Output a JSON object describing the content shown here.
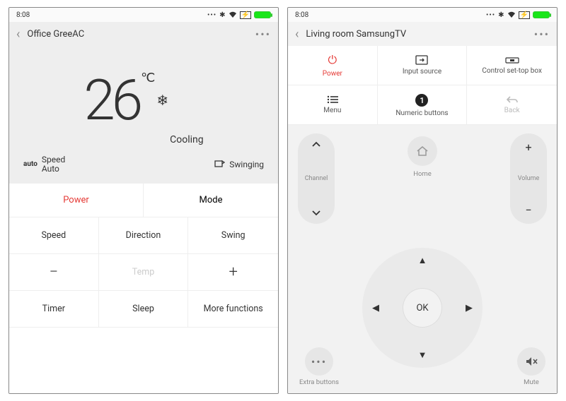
{
  "status": {
    "time": "8:08"
  },
  "left": {
    "title": "Office GreeAC",
    "temperature": "26",
    "unit": "℃",
    "mode_label": "Cooling",
    "speed_label1": "Speed",
    "speed_label2": "Auto",
    "auto_badge": "auto",
    "swing_label": "Swinging",
    "buttons": {
      "power": "Power",
      "mode": "Mode",
      "speed": "Speed",
      "direction": "Direction",
      "swing": "Swing",
      "temp": "Temp",
      "timer": "Timer",
      "sleep": "Sleep",
      "more": "More functions"
    }
  },
  "right": {
    "title": "Living room SamsungTV",
    "tiles": {
      "power": "Power",
      "input": "Input source",
      "stb": "Control set-top box",
      "menu": "Menu",
      "numeric": "Numeric buttons",
      "back": "Back"
    },
    "channel": "Channel",
    "volume": "Volume",
    "home": "Home",
    "ok": "OK",
    "extra": "Extra buttons",
    "mute": "Mute"
  }
}
